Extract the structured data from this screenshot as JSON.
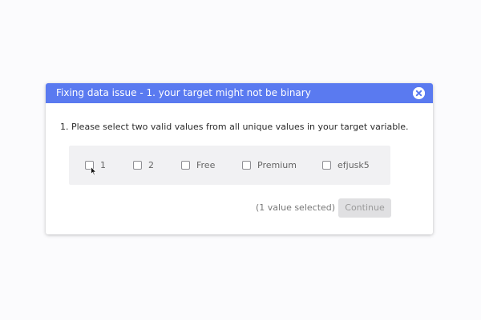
{
  "dialog": {
    "title": "Fixing data issue - 1. your target might not be binary",
    "close_icon": "close-icon",
    "prompt": "1. Please select two valid values from all unique values in your target variable.",
    "options": [
      {
        "label": "1",
        "checked": false
      },
      {
        "label": "2",
        "checked": false
      },
      {
        "label": "Free",
        "checked": false
      },
      {
        "label": "Premium",
        "checked": false
      },
      {
        "label": "efjusk5",
        "checked": false
      }
    ],
    "status_text": "(1 value selected)",
    "continue_label": "Continue",
    "continue_enabled": false
  },
  "colors": {
    "header": "#5a7af0",
    "background": "#fbfbfd",
    "options_box": "#f1f1f3",
    "button_disabled": "#e0e0e2"
  }
}
